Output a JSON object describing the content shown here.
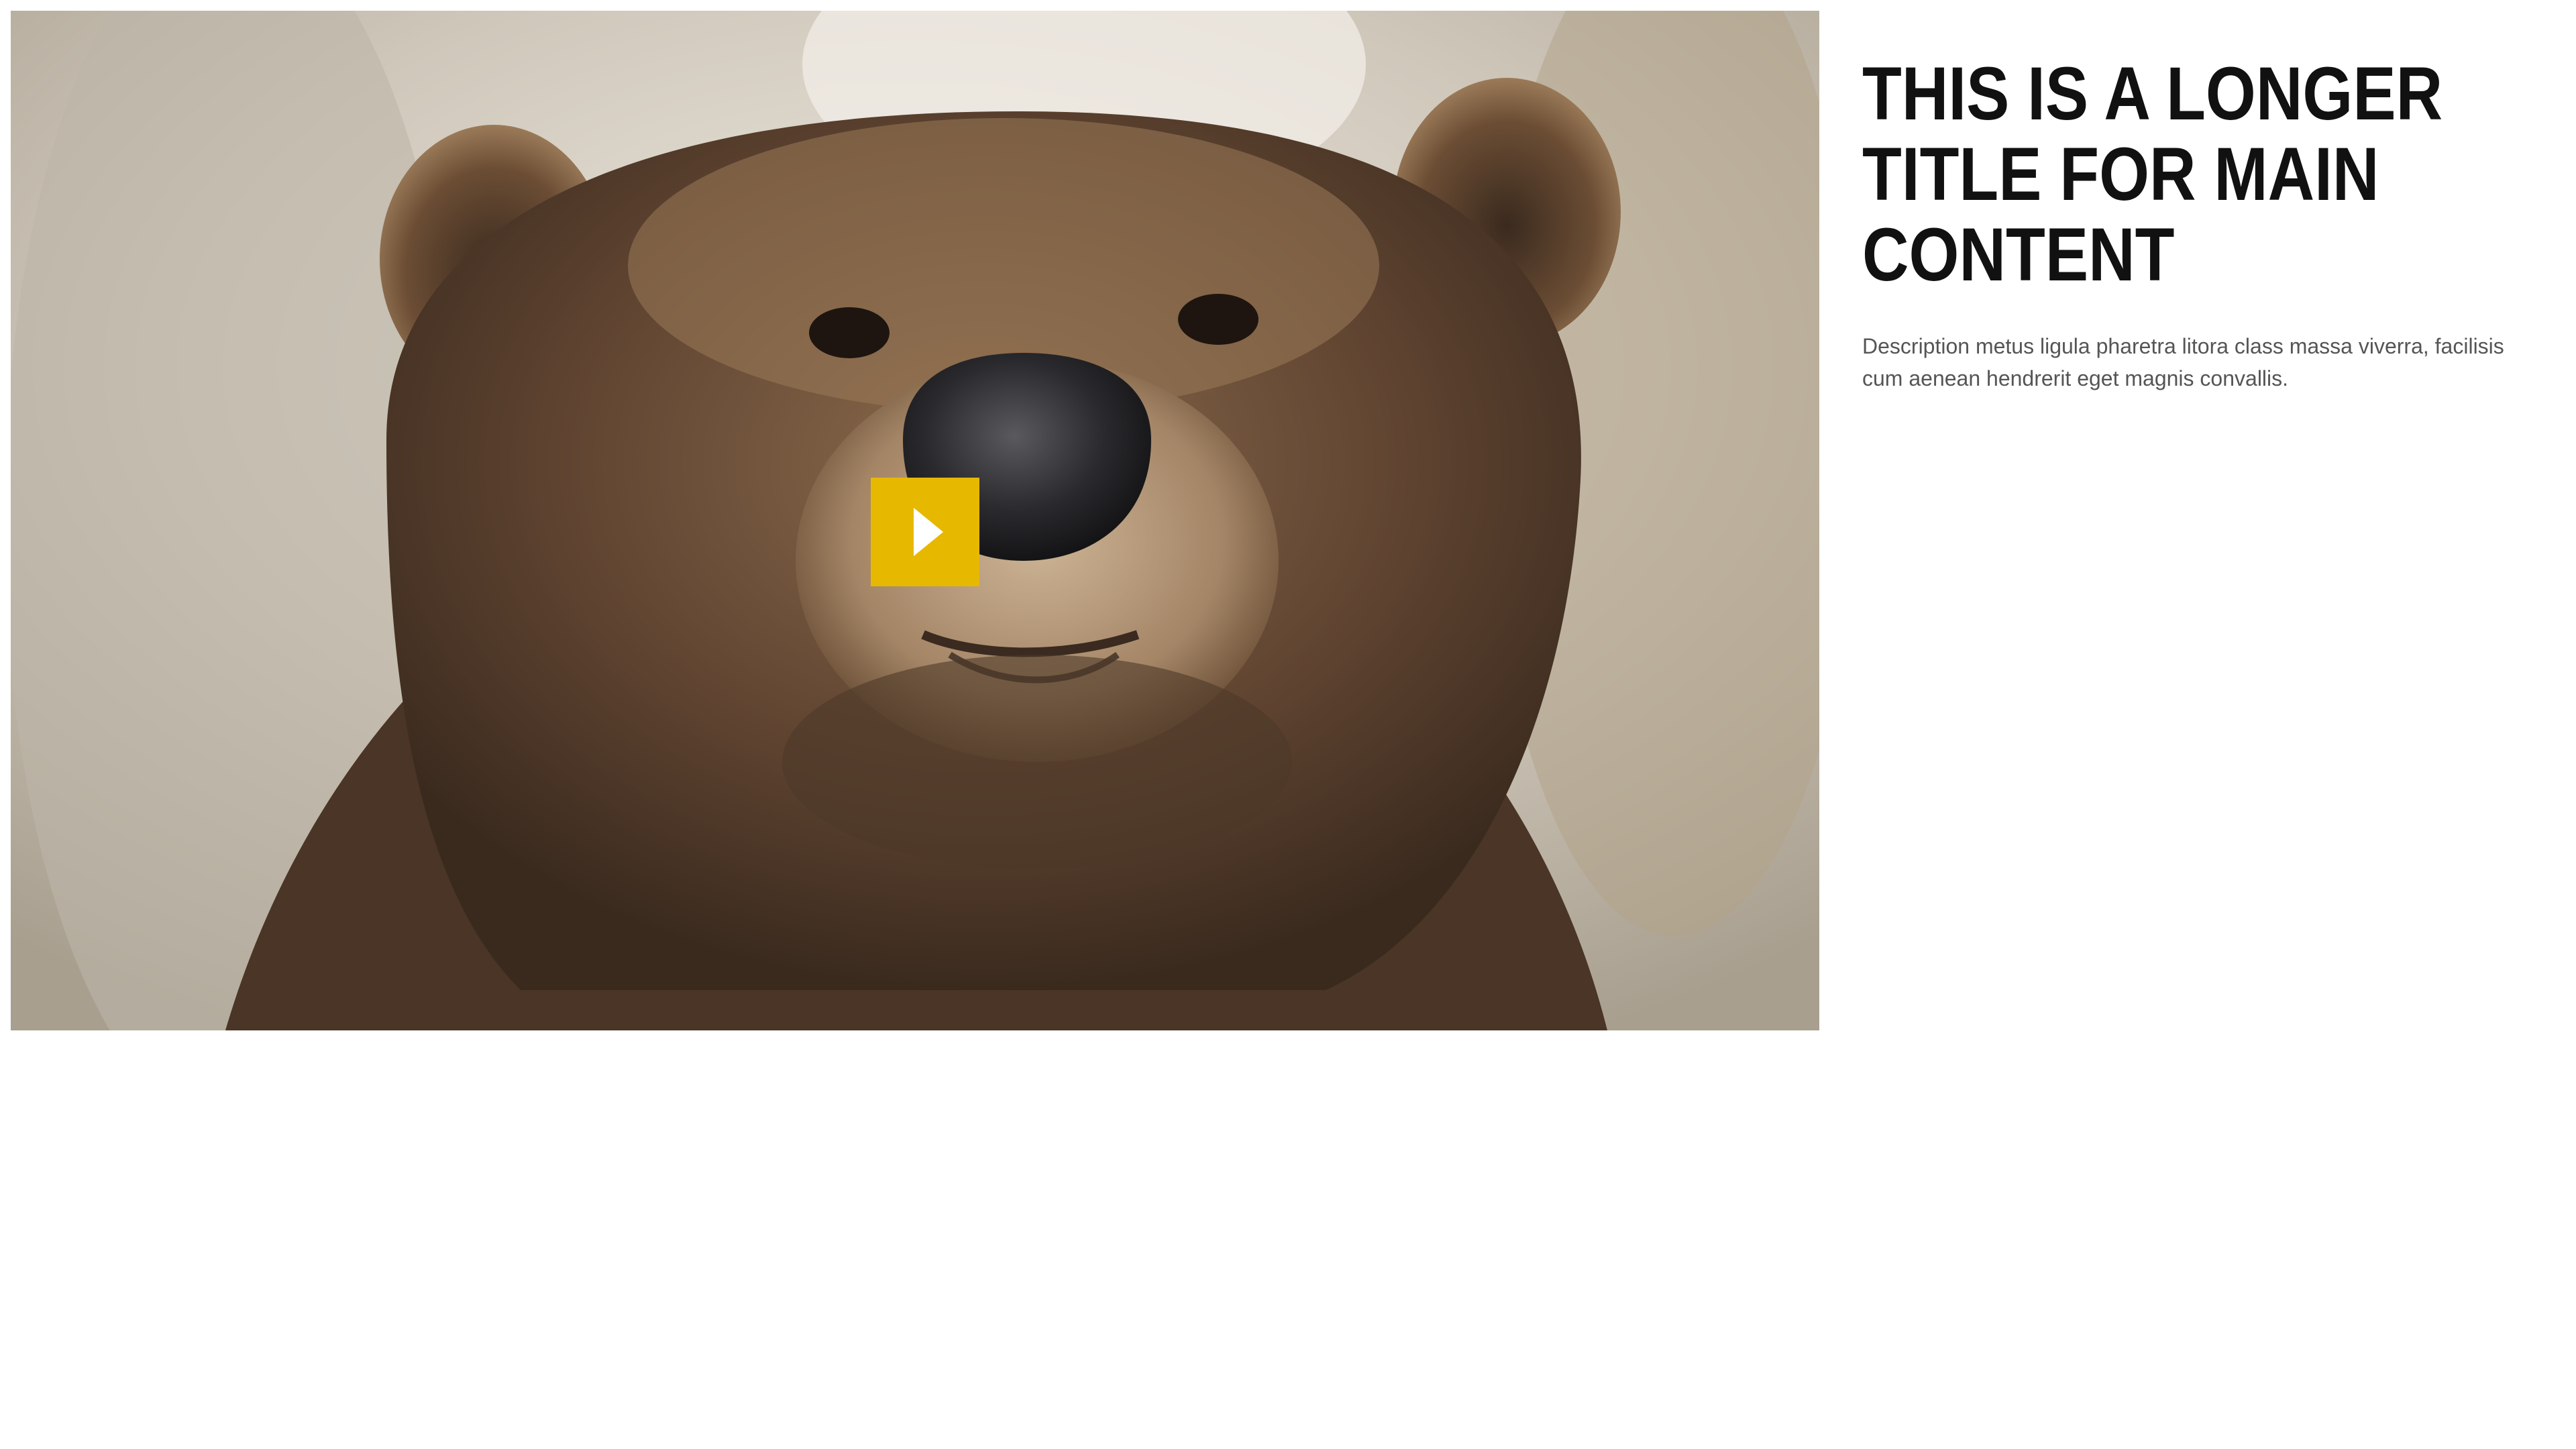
{
  "media": {
    "image_subject": "bear",
    "play_button_color": "#e6b800",
    "play_icon": "play-icon"
  },
  "content": {
    "title": "THIS IS A LONGER TITLE FOR MAIN CONTENT",
    "description": "Description metus ligula pharetra litora class massa viverra, facilisis cum aenean hendrerit eget magnis convallis."
  }
}
